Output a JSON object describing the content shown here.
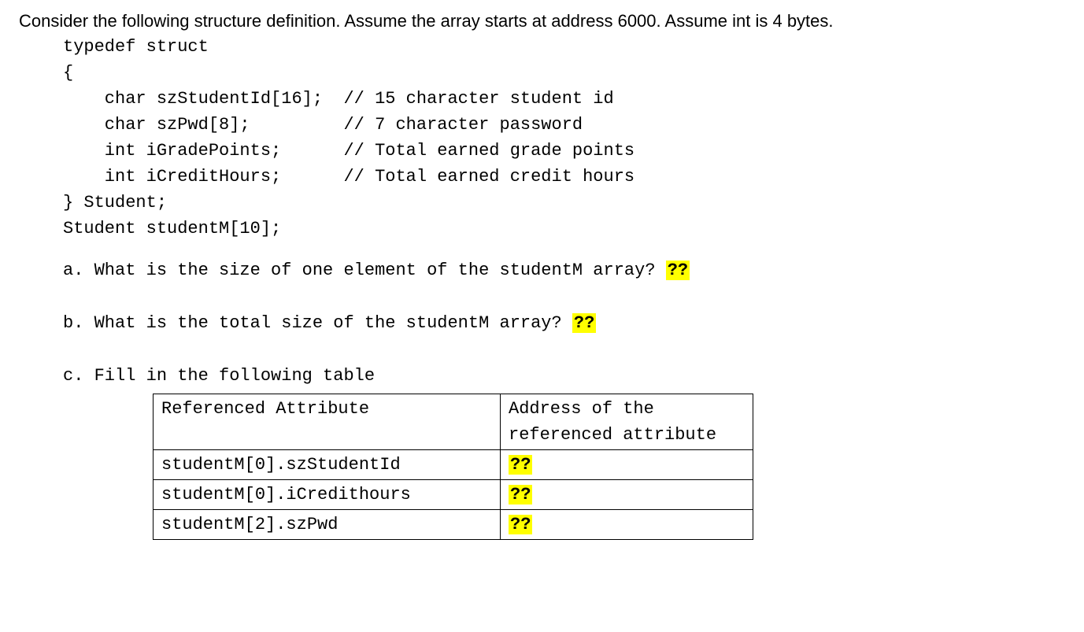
{
  "intro": "Consider the following structure definition.  Assume the array starts at address 6000.  Assume int is 4 bytes.",
  "code": {
    "l1": "typedef struct",
    "l2": "{",
    "l3": "    char szStudentId[16];  // 15 character student id",
    "l4": "    char szPwd[8];         // 7 character password",
    "l5": "    int iGradePoints;      // Total earned grade points",
    "l6": "    int iCreditHours;      // Total earned credit hours",
    "l7": "} Student;",
    "l8": "Student studentM[10];"
  },
  "qa": {
    "a_text": "a. What is the size of one element of the studentM array? ",
    "a_blank": "??",
    "b_text": "b. What is the total size of the studentM array? ",
    "b_blank": "??",
    "c_text": "c. Fill in the following table"
  },
  "table": {
    "header_ref": "Referenced Attribute",
    "header_addr": "Address of the referenced attribute",
    "rows": [
      {
        "ref": "studentM[0].szStudentId",
        "addr": "??"
      },
      {
        "ref": "studentM[0].iCredithours",
        "addr": "??"
      },
      {
        "ref": "studentM[2].szPwd",
        "addr": "??"
      }
    ]
  }
}
